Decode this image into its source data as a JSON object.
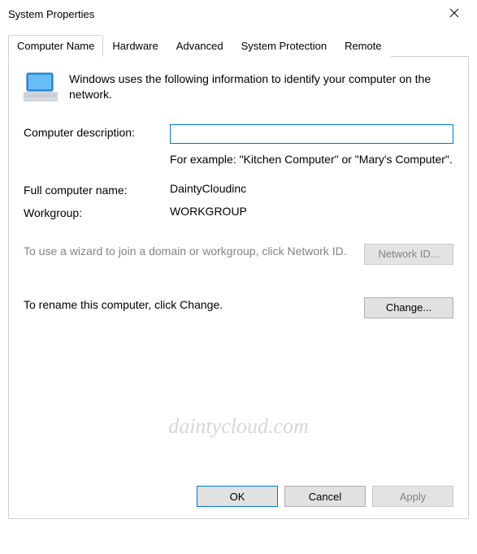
{
  "window": {
    "title": "System Properties"
  },
  "tabs": {
    "computer_name": "Computer Name",
    "hardware": "Hardware",
    "advanced": "Advanced",
    "system_protection": "System Protection",
    "remote": "Remote"
  },
  "panel": {
    "intro": "Windows uses the following information to identify your computer on the network.",
    "desc_label": "Computer description:",
    "desc_value": "",
    "desc_example": "For example: \"Kitchen Computer\" or \"Mary's Computer\".",
    "fullname_label": "Full computer name:",
    "fullname_value": "DaintyCloudinc",
    "workgroup_label": "Workgroup:",
    "workgroup_value": "WORKGROUP",
    "wizard_text": "To use a wizard to join a domain or workgroup, click Network ID.",
    "network_id_btn": "Network ID...",
    "rename_text": "To rename this computer, click Change.",
    "change_btn": "Change..."
  },
  "buttons": {
    "ok": "OK",
    "cancel": "Cancel",
    "apply": "Apply"
  },
  "watermark": "daintycloud.com"
}
